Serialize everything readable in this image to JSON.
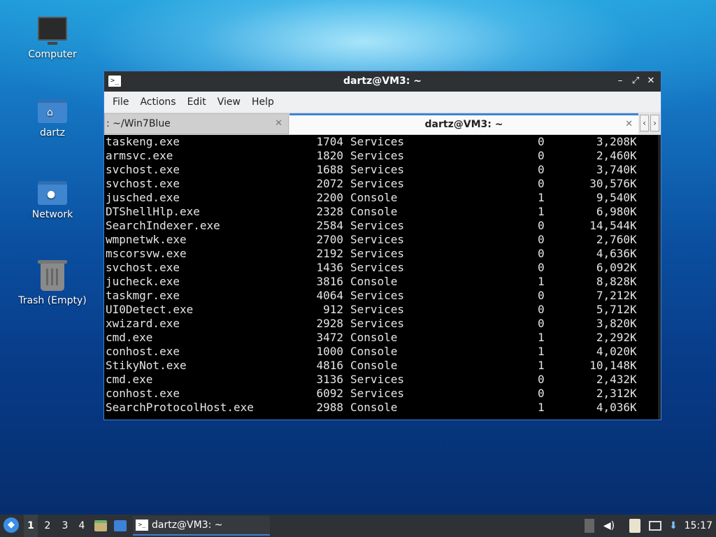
{
  "desktop": {
    "icons": [
      {
        "label": "Computer"
      },
      {
        "label": "dartz"
      },
      {
        "label": "Network"
      },
      {
        "label": "Trash (Empty)"
      }
    ]
  },
  "window": {
    "title": "dartz@VM3: ~",
    "menu": [
      "File",
      "Actions",
      "Edit",
      "View",
      "Help"
    ],
    "tabs": [
      {
        "label": ": ~/Win7Blue"
      },
      {
        "label": "dartz@VM3: ~"
      }
    ]
  },
  "terminal": {
    "rows": [
      {
        "name": "taskeng.exe",
        "pid": "1704",
        "session": "Services",
        "num": "0",
        "mem": "3,208",
        "unit": "K"
      },
      {
        "name": "armsvc.exe",
        "pid": "1820",
        "session": "Services",
        "num": "0",
        "mem": "2,460",
        "unit": "K"
      },
      {
        "name": "svchost.exe",
        "pid": "1688",
        "session": "Services",
        "num": "0",
        "mem": "3,740",
        "unit": "K"
      },
      {
        "name": "svchost.exe",
        "pid": "2072",
        "session": "Services",
        "num": "0",
        "mem": "30,576",
        "unit": "K"
      },
      {
        "name": "jusched.exe",
        "pid": "2200",
        "session": "Console",
        "num": "1",
        "mem": "9,540",
        "unit": "K"
      },
      {
        "name": "DTShellHlp.exe",
        "pid": "2328",
        "session": "Console",
        "num": "1",
        "mem": "6,980",
        "unit": "K"
      },
      {
        "name": "SearchIndexer.exe",
        "pid": "2584",
        "session": "Services",
        "num": "0",
        "mem": "14,544",
        "unit": "K"
      },
      {
        "name": "wmpnetwk.exe",
        "pid": "2700",
        "session": "Services",
        "num": "0",
        "mem": "2,760",
        "unit": "K"
      },
      {
        "name": "mscorsvw.exe",
        "pid": "2192",
        "session": "Services",
        "num": "0",
        "mem": "4,636",
        "unit": "K"
      },
      {
        "name": "svchost.exe",
        "pid": "1436",
        "session": "Services",
        "num": "0",
        "mem": "6,092",
        "unit": "K"
      },
      {
        "name": "jucheck.exe",
        "pid": "3816",
        "session": "Console",
        "num": "1",
        "mem": "8,828",
        "unit": "K"
      },
      {
        "name": "taskmgr.exe",
        "pid": "4064",
        "session": "Services",
        "num": "0",
        "mem": "7,212",
        "unit": "K"
      },
      {
        "name": "UI0Detect.exe",
        "pid": "912",
        "session": "Services",
        "num": "0",
        "mem": "5,712",
        "unit": "K"
      },
      {
        "name": "xwizard.exe",
        "pid": "2928",
        "session": "Services",
        "num": "0",
        "mem": "3,820",
        "unit": "K"
      },
      {
        "name": "cmd.exe",
        "pid": "3472",
        "session": "Console",
        "num": "1",
        "mem": "2,292",
        "unit": "K"
      },
      {
        "name": "conhost.exe",
        "pid": "1000",
        "session": "Console",
        "num": "1",
        "mem": "4,020",
        "unit": "K"
      },
      {
        "name": "StikyNot.exe",
        "pid": "4816",
        "session": "Console",
        "num": "1",
        "mem": "10,148",
        "unit": "K"
      },
      {
        "name": "cmd.exe",
        "pid": "3136",
        "session": "Services",
        "num": "0",
        "mem": "2,432",
        "unit": "K"
      },
      {
        "name": "conhost.exe",
        "pid": "6092",
        "session": "Services",
        "num": "0",
        "mem": "2,312",
        "unit": "K"
      },
      {
        "name": "SearchProtocolHost.exe",
        "pid": "2988",
        "session": "Console",
        "num": "1",
        "mem": "4,036",
        "unit": "K"
      }
    ]
  },
  "taskbar": {
    "workspaces": [
      "1",
      "2",
      "3",
      "4"
    ],
    "task_label": "dartz@VM3: ~",
    "clock": "15:17"
  },
  "colors": {
    "accent": "#3c82d8",
    "terminal_bg": "#000000",
    "terminal_fg": "#e6e6e6"
  }
}
